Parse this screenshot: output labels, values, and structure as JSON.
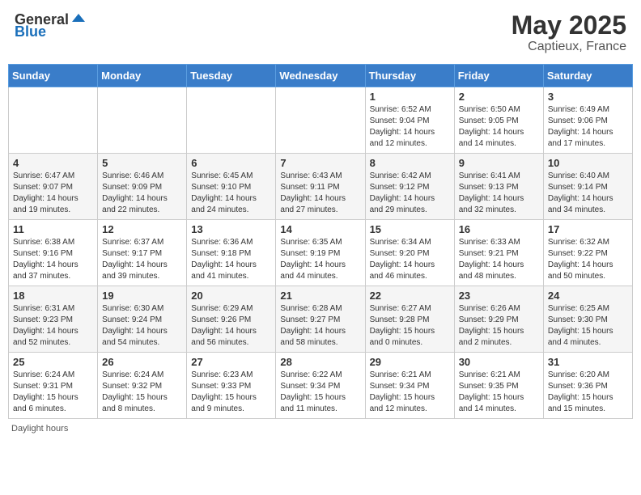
{
  "header": {
    "logo_general": "General",
    "logo_blue": "Blue",
    "month": "May 2025",
    "location": "Captieux, France"
  },
  "days_of_week": [
    "Sunday",
    "Monday",
    "Tuesday",
    "Wednesday",
    "Thursday",
    "Friday",
    "Saturday"
  ],
  "footer": {
    "daylight_hours": "Daylight hours"
  },
  "weeks": [
    {
      "days": [
        {
          "num": "",
          "info": ""
        },
        {
          "num": "",
          "info": ""
        },
        {
          "num": "",
          "info": ""
        },
        {
          "num": "",
          "info": ""
        },
        {
          "num": "1",
          "info": "Sunrise: 6:52 AM\nSunset: 9:04 PM\nDaylight: 14 hours\nand 12 minutes."
        },
        {
          "num": "2",
          "info": "Sunrise: 6:50 AM\nSunset: 9:05 PM\nDaylight: 14 hours\nand 14 minutes."
        },
        {
          "num": "3",
          "info": "Sunrise: 6:49 AM\nSunset: 9:06 PM\nDaylight: 14 hours\nand 17 minutes."
        }
      ]
    },
    {
      "days": [
        {
          "num": "4",
          "info": "Sunrise: 6:47 AM\nSunset: 9:07 PM\nDaylight: 14 hours\nand 19 minutes."
        },
        {
          "num": "5",
          "info": "Sunrise: 6:46 AM\nSunset: 9:09 PM\nDaylight: 14 hours\nand 22 minutes."
        },
        {
          "num": "6",
          "info": "Sunrise: 6:45 AM\nSunset: 9:10 PM\nDaylight: 14 hours\nand 24 minutes."
        },
        {
          "num": "7",
          "info": "Sunrise: 6:43 AM\nSunset: 9:11 PM\nDaylight: 14 hours\nand 27 minutes."
        },
        {
          "num": "8",
          "info": "Sunrise: 6:42 AM\nSunset: 9:12 PM\nDaylight: 14 hours\nand 29 minutes."
        },
        {
          "num": "9",
          "info": "Sunrise: 6:41 AM\nSunset: 9:13 PM\nDaylight: 14 hours\nand 32 minutes."
        },
        {
          "num": "10",
          "info": "Sunrise: 6:40 AM\nSunset: 9:14 PM\nDaylight: 14 hours\nand 34 minutes."
        }
      ]
    },
    {
      "days": [
        {
          "num": "11",
          "info": "Sunrise: 6:38 AM\nSunset: 9:16 PM\nDaylight: 14 hours\nand 37 minutes."
        },
        {
          "num": "12",
          "info": "Sunrise: 6:37 AM\nSunset: 9:17 PM\nDaylight: 14 hours\nand 39 minutes."
        },
        {
          "num": "13",
          "info": "Sunrise: 6:36 AM\nSunset: 9:18 PM\nDaylight: 14 hours\nand 41 minutes."
        },
        {
          "num": "14",
          "info": "Sunrise: 6:35 AM\nSunset: 9:19 PM\nDaylight: 14 hours\nand 44 minutes."
        },
        {
          "num": "15",
          "info": "Sunrise: 6:34 AM\nSunset: 9:20 PM\nDaylight: 14 hours\nand 46 minutes."
        },
        {
          "num": "16",
          "info": "Sunrise: 6:33 AM\nSunset: 9:21 PM\nDaylight: 14 hours\nand 48 minutes."
        },
        {
          "num": "17",
          "info": "Sunrise: 6:32 AM\nSunset: 9:22 PM\nDaylight: 14 hours\nand 50 minutes."
        }
      ]
    },
    {
      "days": [
        {
          "num": "18",
          "info": "Sunrise: 6:31 AM\nSunset: 9:23 PM\nDaylight: 14 hours\nand 52 minutes."
        },
        {
          "num": "19",
          "info": "Sunrise: 6:30 AM\nSunset: 9:24 PM\nDaylight: 14 hours\nand 54 minutes."
        },
        {
          "num": "20",
          "info": "Sunrise: 6:29 AM\nSunset: 9:26 PM\nDaylight: 14 hours\nand 56 minutes."
        },
        {
          "num": "21",
          "info": "Sunrise: 6:28 AM\nSunset: 9:27 PM\nDaylight: 14 hours\nand 58 minutes."
        },
        {
          "num": "22",
          "info": "Sunrise: 6:27 AM\nSunset: 9:28 PM\nDaylight: 15 hours\nand 0 minutes."
        },
        {
          "num": "23",
          "info": "Sunrise: 6:26 AM\nSunset: 9:29 PM\nDaylight: 15 hours\nand 2 minutes."
        },
        {
          "num": "24",
          "info": "Sunrise: 6:25 AM\nSunset: 9:30 PM\nDaylight: 15 hours\nand 4 minutes."
        }
      ]
    },
    {
      "days": [
        {
          "num": "25",
          "info": "Sunrise: 6:24 AM\nSunset: 9:31 PM\nDaylight: 15 hours\nand 6 minutes."
        },
        {
          "num": "26",
          "info": "Sunrise: 6:24 AM\nSunset: 9:32 PM\nDaylight: 15 hours\nand 8 minutes."
        },
        {
          "num": "27",
          "info": "Sunrise: 6:23 AM\nSunset: 9:33 PM\nDaylight: 15 hours\nand 9 minutes."
        },
        {
          "num": "28",
          "info": "Sunrise: 6:22 AM\nSunset: 9:34 PM\nDaylight: 15 hours\nand 11 minutes."
        },
        {
          "num": "29",
          "info": "Sunrise: 6:21 AM\nSunset: 9:34 PM\nDaylight: 15 hours\nand 12 minutes."
        },
        {
          "num": "30",
          "info": "Sunrise: 6:21 AM\nSunset: 9:35 PM\nDaylight: 15 hours\nand 14 minutes."
        },
        {
          "num": "31",
          "info": "Sunrise: 6:20 AM\nSunset: 9:36 PM\nDaylight: 15 hours\nand 15 minutes."
        }
      ]
    }
  ]
}
